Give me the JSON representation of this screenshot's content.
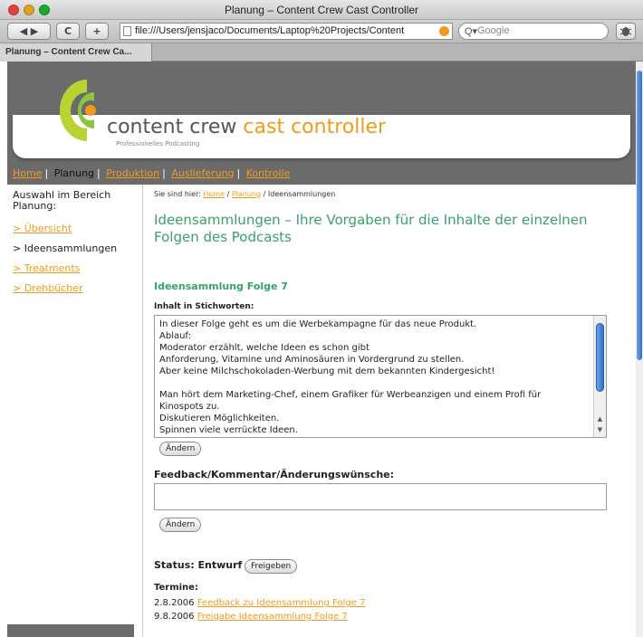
{
  "window": {
    "title": "Planung – Content Crew Cast Controller"
  },
  "toolbar": {
    "back_forward": "◀ ▶",
    "reload": "C",
    "add": "+",
    "url": "file:///Users/jensjaco/Documents/Laptop%20Projects/Content",
    "search_placeholder": "Google",
    "search_prefix": "Q▾"
  },
  "tabs": [
    {
      "label": "Planung – Content Crew Ca..."
    }
  ],
  "header": {
    "brand_main": "content crew",
    "brand_accent": "cast controller",
    "tagline": "Professionelles Podcasting"
  },
  "nav": {
    "items": [
      {
        "label": "Home",
        "current": false
      },
      {
        "label": "Planung",
        "current": true
      },
      {
        "label": "Produktion",
        "current": false
      },
      {
        "label": "Auslieferung",
        "current": false
      },
      {
        "label": "Kontrolle",
        "current": false
      }
    ]
  },
  "sidebar": {
    "title": "Auswahl im Bereich Planung:",
    "items": [
      {
        "label": "> Übersicht",
        "link": true
      },
      {
        "label": "> Ideensammlungen",
        "link": false
      },
      {
        "label": "> Treatments",
        "link": true
      },
      {
        "label": "> Drehbücher",
        "link": true
      }
    ]
  },
  "breadcrumb": {
    "prefix": "Sie sind hier:",
    "home": "Home",
    "sep1": "/",
    "planung": "Planung",
    "sep2": "/",
    "current": "Ideensammlungen"
  },
  "main": {
    "heading": "Ideensammlungen – Ihre Vorgaben für die Inhalte der einzelnen Folgen des Podcasts",
    "subheading": "Ideensammlung Folge 7",
    "content_label": "Inhalt in Stichworten:",
    "content_lines": [
      "In dieser Folge geht es um die Werbekampagne für das neue Produkt.",
      "Ablauf:",
      "Moderator erzählt, welche Ideen es schon gibt",
      "Anforderung, Vitamine und Aminosäuren in Vordergrund zu stellen.",
      "Aber keine Milchschokoladen-Werbung mit dem bekannten Kindergesicht!",
      "",
      "Man hört dem Marketing-Chef, einem Grafiker für Werbeanzigen und einem Profi für",
      "Kinospots zu.",
      "Diskutieren Möglichkeiten.",
      "Spinnen viele verrückte Ideen."
    ],
    "change_button": "Ändern",
    "feedback_label": "Feedback/Kommentar/Änderungswünsche:",
    "feedback_value": "",
    "change_button2": "Ändern",
    "status_label": "Status: Entwurf",
    "release_button": "Freigeben",
    "termine_label": "Termine:",
    "termine": [
      {
        "date": "2.8.2006",
        "text": "Feedback zu Ideensammlung Folge 7"
      },
      {
        "date": "9.8.2006",
        "text": "Freigabe Ideensammlung Folge 7"
      }
    ]
  },
  "colors": {
    "accent_orange": "#f39a1e",
    "heading_green": "#3aa06f",
    "header_gray": "#6b6b6b"
  }
}
